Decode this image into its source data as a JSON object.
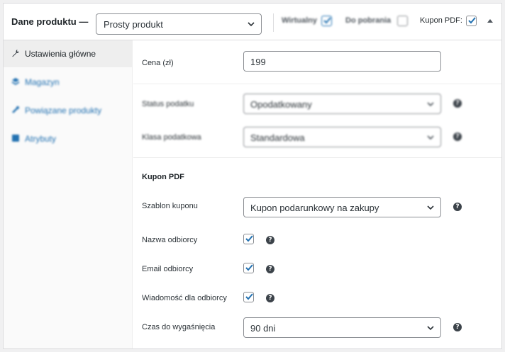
{
  "header": {
    "title": "Dane produktu —",
    "product_type": "Prosty produkt",
    "options": [
      {
        "label": "Wirtualny",
        "checked": true
      },
      {
        "label": "Do pobrania",
        "checked": false
      },
      {
        "label": "Kupon PDF:",
        "checked": true
      }
    ]
  },
  "sidebar": {
    "items": [
      {
        "label": "Ustawienia główne",
        "icon": "wrench-icon",
        "active": true
      },
      {
        "label": "Magazyn",
        "icon": "inventory-icon",
        "active": false
      },
      {
        "label": "Powiązane produkty",
        "icon": "link-icon",
        "active": false
      },
      {
        "label": "Atrybuty",
        "icon": "list-icon",
        "active": false
      }
    ]
  },
  "general": {
    "price_label": "Cena (zł)",
    "price_value": "199",
    "tax_status_label": "Status podatku",
    "tax_status_value": "Opodatkowany",
    "tax_class_label": "Klasa podatkowa",
    "tax_class_value": "Standardowa"
  },
  "pdf_coupon": {
    "section_title": "Kupon PDF",
    "template_label": "Szablon kuponu",
    "template_value": "Kupon podarunkowy na zakupy",
    "recipient_name_label": "Nazwa odbiorcy",
    "recipient_name_checked": true,
    "recipient_email_label": "Email odbiorcy",
    "recipient_email_checked": true,
    "recipient_message_label": "Wiadomość dla odbiorcy",
    "recipient_message_checked": true,
    "expiry_label": "Czas do wygaśnięcia",
    "expiry_value": "90 dni"
  },
  "colors": {
    "accent": "#2271b1",
    "border": "#8c8f94",
    "text": "#1d2327"
  }
}
